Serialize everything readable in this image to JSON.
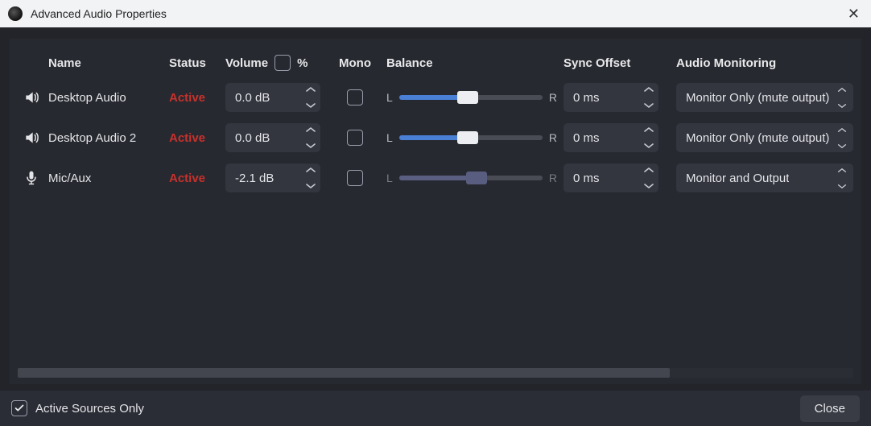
{
  "window": {
    "title": "Advanced Audio Properties"
  },
  "headers": {
    "name": "Name",
    "status": "Status",
    "volume": "Volume",
    "volume_suffix": "%",
    "mono": "Mono",
    "balance": "Balance",
    "sync": "Sync Offset",
    "monitoring": "Audio Monitoring"
  },
  "rows": [
    {
      "icon": "speaker",
      "name": "Desktop Audio",
      "status": "Active",
      "volume": "0.0 dB",
      "mono": false,
      "balance_pct": 48,
      "balance_active": true,
      "balance_l": "L",
      "balance_r": "R",
      "sync": "0 ms",
      "monitoring": "Monitor Only (mute output)"
    },
    {
      "icon": "speaker",
      "name": "Desktop Audio 2",
      "status": "Active",
      "volume": "0.0 dB",
      "mono": false,
      "balance_pct": 48,
      "balance_active": true,
      "balance_l": "L",
      "balance_r": "R",
      "sync": "0 ms",
      "monitoring": "Monitor Only (mute output)"
    },
    {
      "icon": "mic",
      "name": "Mic/Aux",
      "status": "Active",
      "volume": "-2.1 dB",
      "mono": false,
      "balance_pct": 54,
      "balance_active": false,
      "balance_l": "L",
      "balance_r": "R",
      "sync": "0 ms",
      "monitoring": "Monitor and Output"
    }
  ],
  "footer": {
    "active_only": "Active Sources Only",
    "active_only_checked": true,
    "close": "Close"
  }
}
